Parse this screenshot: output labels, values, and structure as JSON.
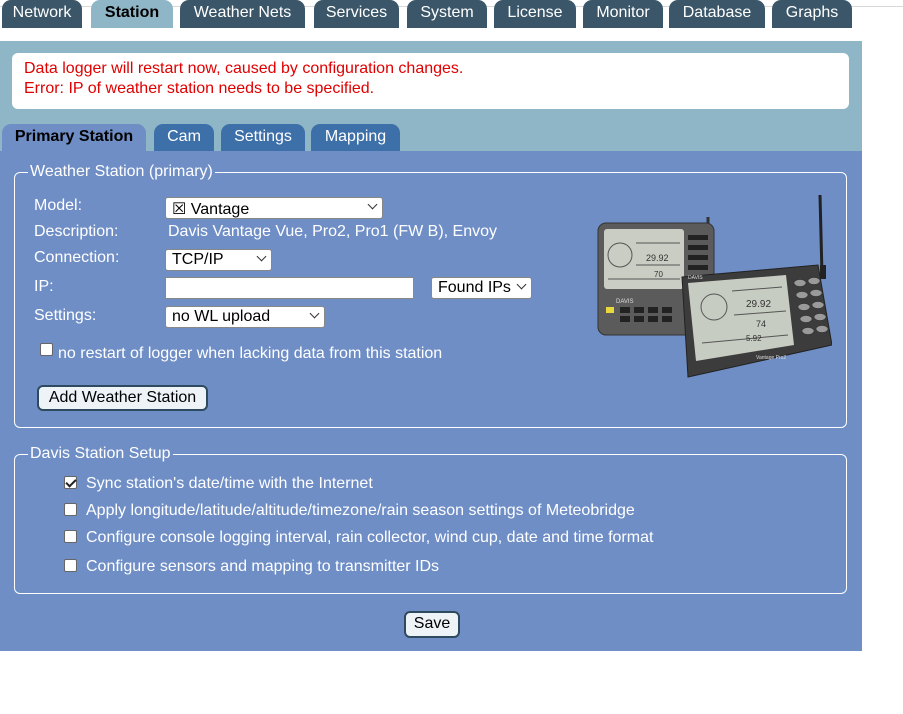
{
  "top_tabs": [
    {
      "label": "Network",
      "active": false
    },
    {
      "label": "Station",
      "active": true
    },
    {
      "label": "Weather Nets",
      "active": false
    },
    {
      "label": "Services",
      "active": false
    },
    {
      "label": "System",
      "active": false
    },
    {
      "label": "License",
      "active": false
    },
    {
      "label": "Monitor",
      "active": false
    },
    {
      "label": "Database",
      "active": false
    },
    {
      "label": "Graphs",
      "active": false
    }
  ],
  "messages": {
    "line1": "Data logger will restart now, caused by configuration changes.",
    "line2": "Error: IP of weather station needs to be specified."
  },
  "sub_tabs": [
    {
      "label": "Primary Station",
      "active": true
    },
    {
      "label": "Cam",
      "active": false
    },
    {
      "label": "Settings",
      "active": false
    },
    {
      "label": "Mapping",
      "active": false
    }
  ],
  "primary": {
    "legend": "Weather Station (primary)",
    "model_label": "Model:",
    "model_value": "☒ Vantage",
    "description_label": "Description:",
    "description_value": "Davis Vantage Vue, Pro2, Pro1 (FW B), Envoy",
    "connection_label": "Connection:",
    "connection_value": "TCP/IP",
    "ip_label": "IP:",
    "ip_value": "",
    "found_ips": "Found IPs",
    "settings_label": "Settings:",
    "settings_value": "no WL upload",
    "no_restart_label": "no restart of logger when lacking data from this station",
    "no_restart_checked": false,
    "add_button": "Add Weather Station"
  },
  "davis": {
    "legend": "Davis Station Setup",
    "options": [
      {
        "label": "Sync station's date/time with the Internet",
        "checked": true
      },
      {
        "label": "Apply longitude/latitude/altitude/timezone/rain season settings of Meteobridge",
        "checked": false
      },
      {
        "label": "Configure console logging interval, rain collector, wind cup, date and time format",
        "checked": false
      },
      {
        "label": "Configure sensors and mapping to transmitter IDs",
        "checked": false
      }
    ]
  },
  "save_label": "Save",
  "console_screen_text": {
    "back_brand": "DAVIS",
    "front_brand": "DAVIS",
    "front_model": "Vantage Pro2",
    "back_readout_1": "29.92",
    "back_readout_2": "70",
    "front_readout_1": "29.92",
    "front_readout_2": "74",
    "front_readout_3": "5.92"
  },
  "colors": {
    "header_band": "#8fb6c6",
    "panel": "#6f8ec6",
    "tab_dark": "#3a5668",
    "subtab_dark": "#3d6fa8",
    "error": "#e00000"
  }
}
